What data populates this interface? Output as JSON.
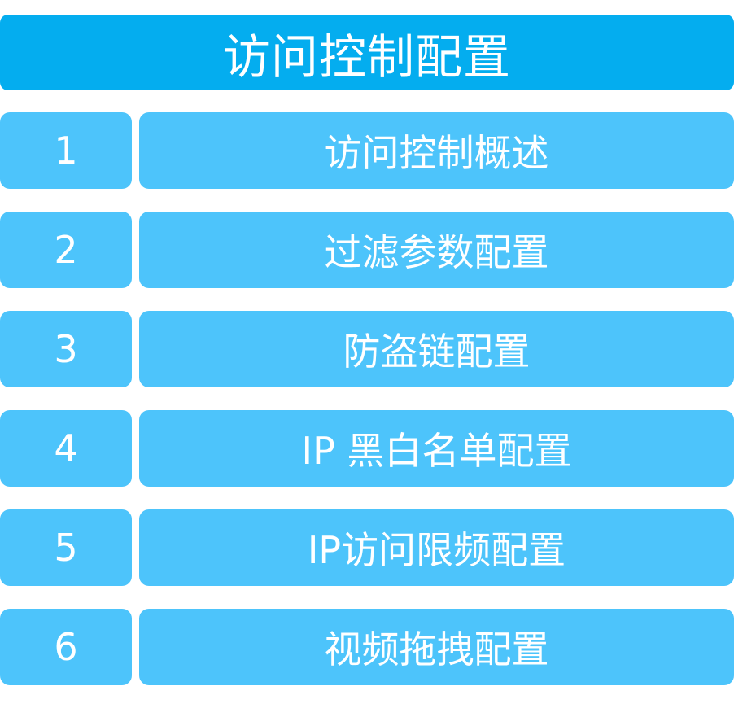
{
  "title": "访问控制配置",
  "items": [
    {
      "number": "1",
      "label": "访问控制概述"
    },
    {
      "number": "2",
      "label": "过滤参数配置"
    },
    {
      "number": "3",
      "label": "防盗链配置"
    },
    {
      "number": "4",
      "label": "IP 黑白名单配置"
    },
    {
      "number": "5",
      "label": "IP访问限频配置"
    },
    {
      "number": "6",
      "label": "视频拖拽配置"
    }
  ],
  "colors": {
    "title_background": "#04adef",
    "item_background": "#4dc4fb",
    "text": "#ffffff"
  }
}
